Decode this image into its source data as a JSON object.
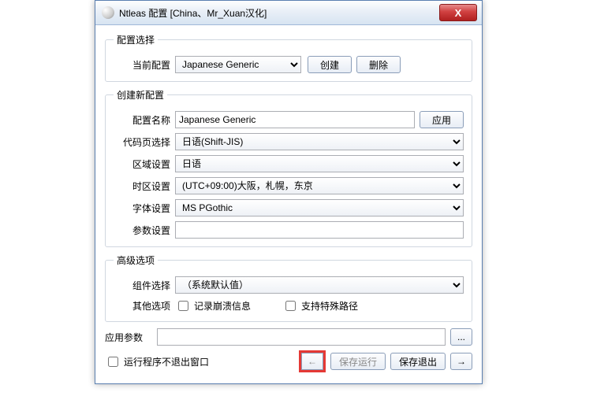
{
  "window": {
    "title": "Ntleas 配置 [China、Mr_Xuan汉化]"
  },
  "config_select": {
    "legend": "配置选择",
    "current_label": "当前配置",
    "current_value": "Japanese Generic",
    "create": "创建",
    "delete": "删除"
  },
  "create_config": {
    "legend": "创建新配置",
    "name_label": "配置名称",
    "name_value": "Japanese Generic",
    "apply": "应用",
    "codepage_label": "代码页选择",
    "codepage_value": "日语(Shift-JIS)",
    "locale_label": "区域设置",
    "locale_value": "日语",
    "tz_label": "时区设置",
    "tz_value": "(UTC+09:00)大阪，札幌，东京",
    "font_label": "字体设置",
    "font_value": "MS PGothic",
    "param_label": "参数设置",
    "param_value": ""
  },
  "advanced": {
    "legend": "高级选项",
    "component_label": "组件选择",
    "component_value": "（系统默认值）",
    "other_label": "其他选项",
    "chk_crash": "记录崩溃信息",
    "chk_special": "支持特殊路径"
  },
  "app_params": {
    "label": "应用参数",
    "value": "",
    "browse": "..."
  },
  "footer": {
    "chk_noexit": "运行程序不退出窗口",
    "back": "←",
    "save_run": "保存运行",
    "save_exit": "保存退出",
    "forward": "→"
  }
}
